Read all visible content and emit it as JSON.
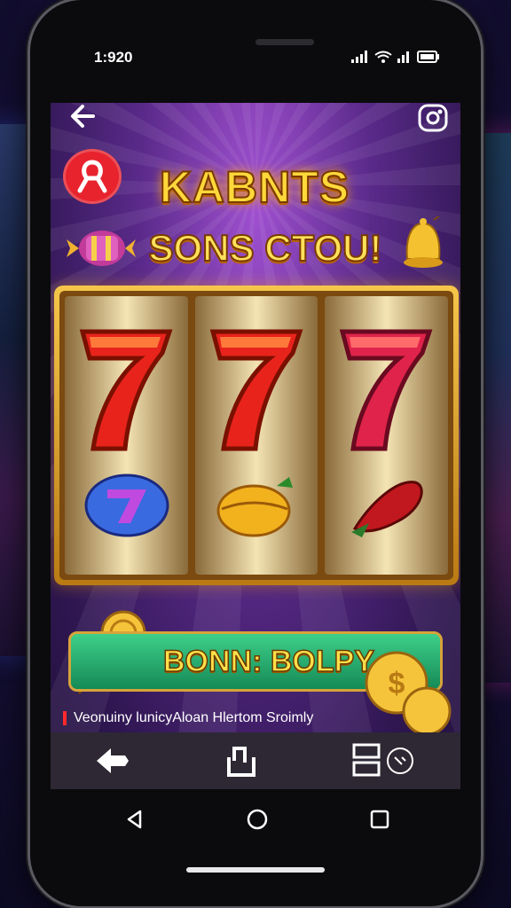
{
  "status_bar": {
    "time": "1:920"
  },
  "header": {
    "badge_icon": "ribbon-icon",
    "top_right_icon": "profile-icon"
  },
  "title": {
    "line1": "KABNTS",
    "line2": "SONS CTOU!"
  },
  "reels": [
    {
      "top": "seven",
      "bottom": "blue-seven"
    },
    {
      "top": "seven",
      "bottom": "golden-fruit"
    },
    {
      "top": "seven",
      "bottom": "red-pepper"
    }
  ],
  "bonus_button": {
    "label": "BONN: BOLPY"
  },
  "ticker": {
    "text": "Veonuiny lunicyAloan Hlertom Sroimly"
  },
  "colors": {
    "accent_gold": "#ffd83a",
    "bonus_green": "#2fb874",
    "badge_red": "#e8232d",
    "screen_purple": "#5a2a8a"
  }
}
